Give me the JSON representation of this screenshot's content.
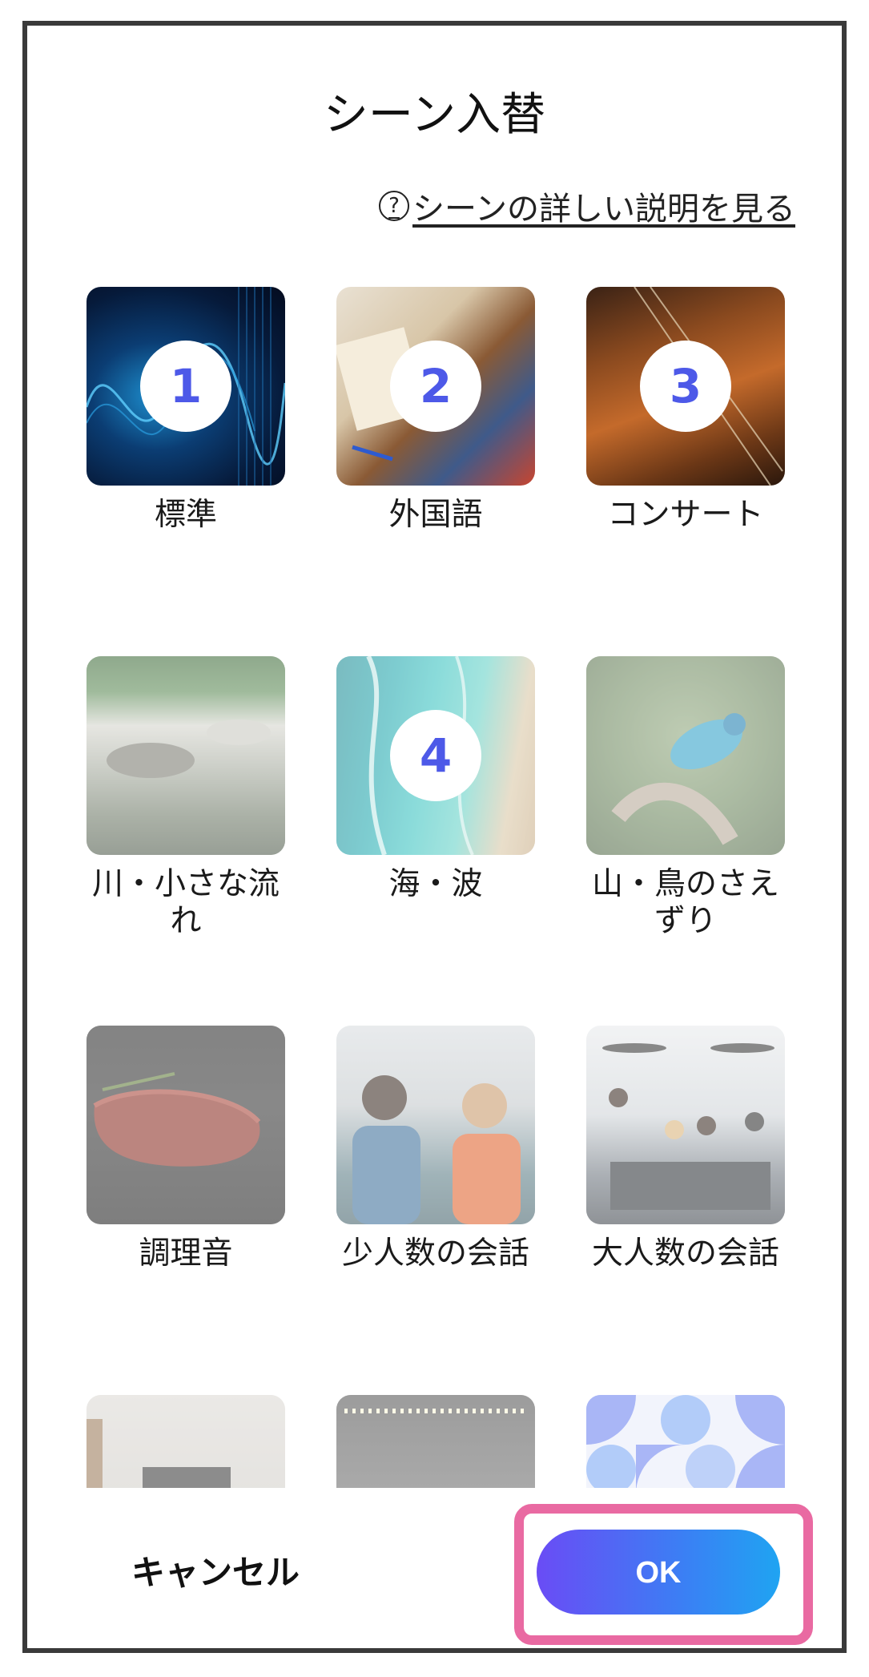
{
  "dialog": {
    "title": "シーン入替",
    "help_icon": "?",
    "help_link": "シーンの詳しい説明を見る"
  },
  "scenes": [
    {
      "label": "標準",
      "badge": "1"
    },
    {
      "label": "外国語",
      "badge": "2"
    },
    {
      "label": "コンサート",
      "badge": "3"
    },
    {
      "label": "川・小さな流れ",
      "badge": ""
    },
    {
      "label": "海・波",
      "badge": "4"
    },
    {
      "label": "山・鳥のさえずり",
      "badge": ""
    },
    {
      "label": "調理音",
      "badge": ""
    },
    {
      "label": "少人数の会話",
      "badge": ""
    },
    {
      "label": "大人数の会話",
      "badge": ""
    },
    {
      "label": "",
      "badge": ""
    },
    {
      "label": "",
      "badge": ""
    },
    {
      "label": "",
      "badge": ""
    }
  ],
  "footer": {
    "cancel_label": "キャンセル",
    "ok_label": "OK"
  },
  "colors": {
    "badge_text": "#4d59e8",
    "ok_gradient_start": "#6a4cf5",
    "ok_gradient_end": "#1fa4f2",
    "highlight_border": "#e96aa2"
  }
}
